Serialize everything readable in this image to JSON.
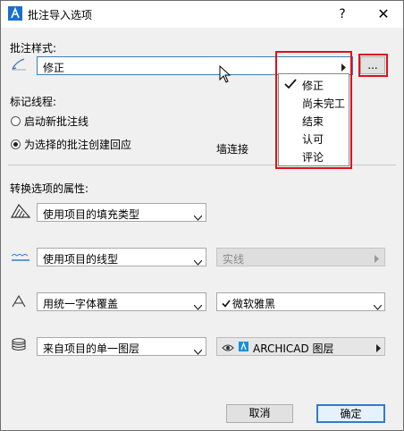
{
  "window": {
    "title": "批注导入选项",
    "help": "?",
    "close": "✕"
  },
  "markup_style": {
    "label": "批注样式:",
    "value": "修正",
    "more_button": "...",
    "options": [
      "修正",
      "尚未完工",
      "结束",
      "认可",
      "评论"
    ],
    "selected_option": "修正"
  },
  "marker_line": {
    "label": "标记线程:",
    "radio_new": "启动新批注线",
    "radio_reply": "为选择的批注创建回应",
    "selected": "radio_reply"
  },
  "wall_connect_label": "墙连接",
  "convert": {
    "label": "转换选项的属性:",
    "fill": "使用项目的填充类型",
    "line": "使用项目的线型",
    "line_disabled_value": "实线",
    "font": "用统一字体覆盖",
    "font_name": "微软雅黑",
    "layer": "来自项目的单一图层",
    "layer_name": "ARCHICAD 图层"
  },
  "buttons": {
    "cancel": "取消",
    "ok": "确定"
  },
  "colors": {
    "highlight_red": "#e0101a",
    "field_selected_border": "#3c7fb1"
  }
}
